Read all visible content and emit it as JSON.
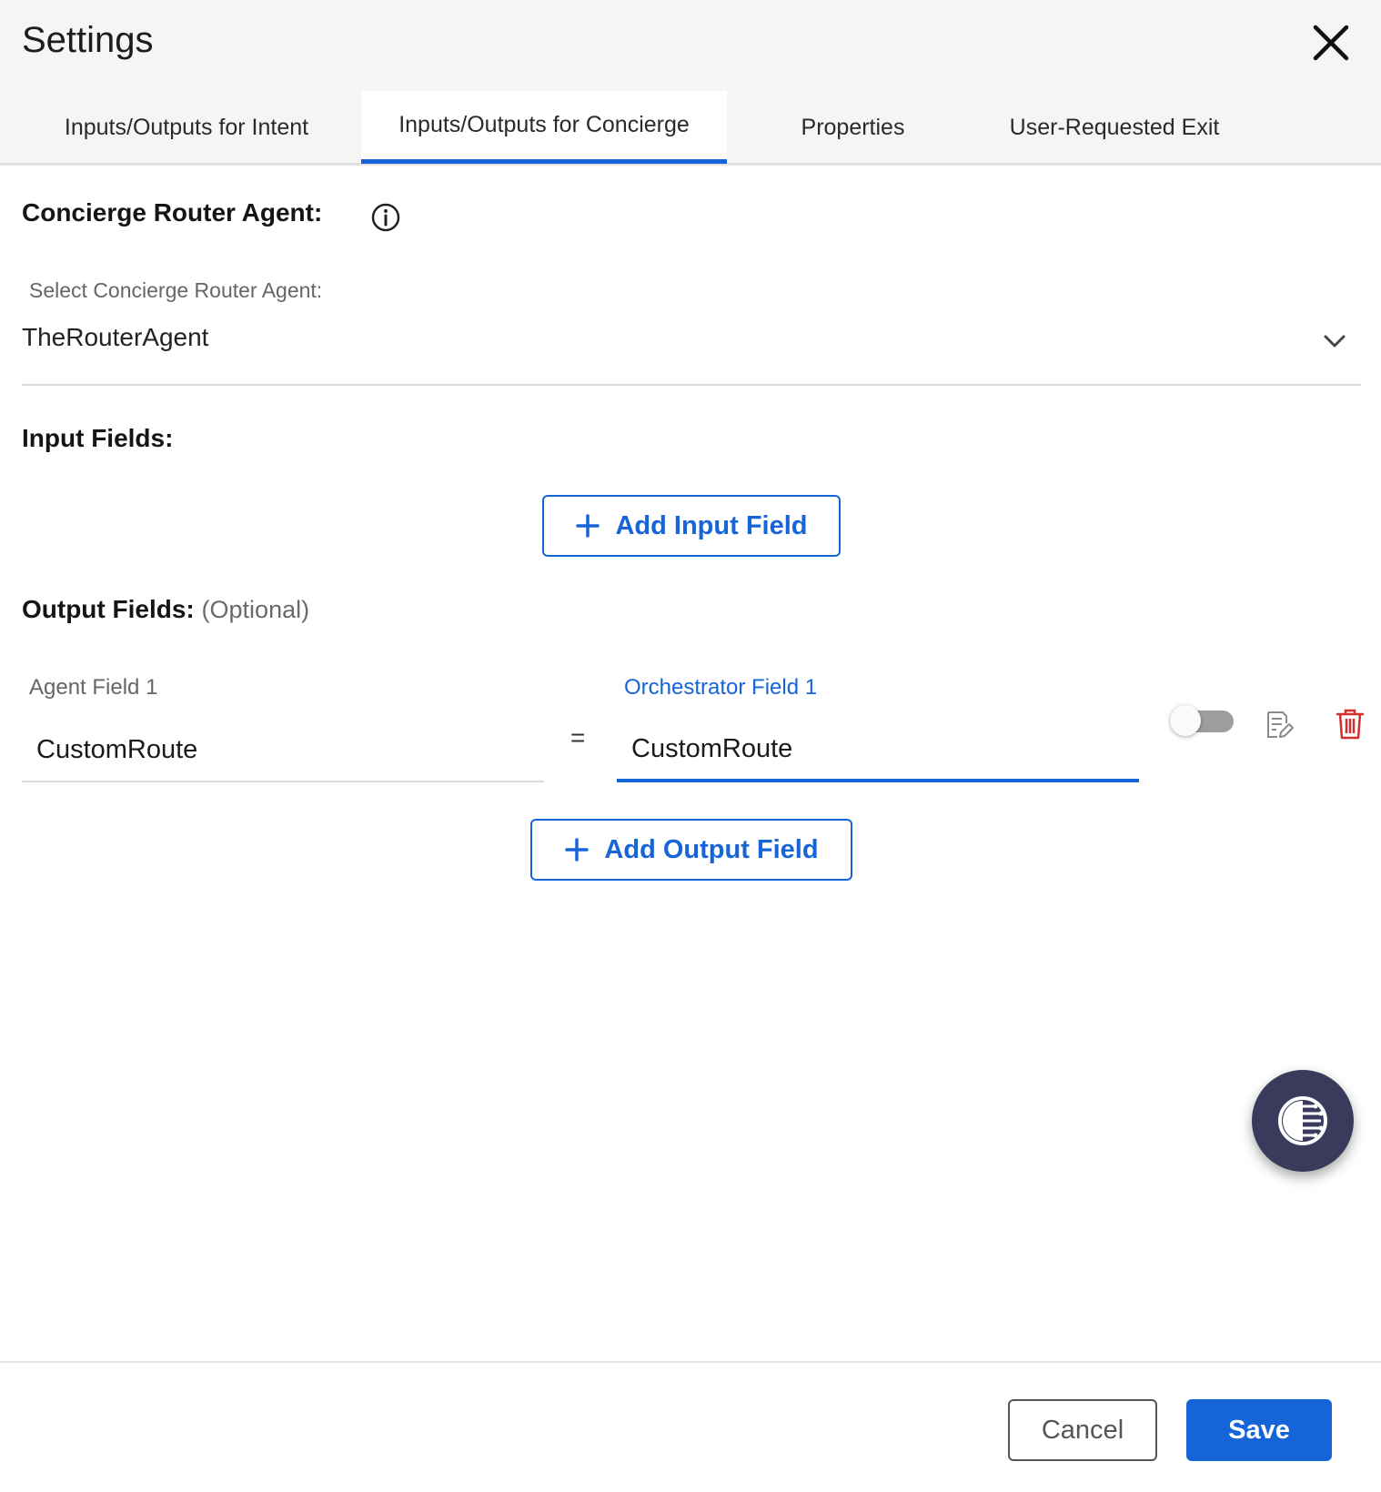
{
  "dialog": {
    "title": "Settings"
  },
  "tabs": [
    {
      "label": "Inputs/Outputs for Intent",
      "active": false
    },
    {
      "label": "Inputs/Outputs for Concierge",
      "active": true
    },
    {
      "label": "Properties",
      "active": false
    },
    {
      "label": "User-Requested Exit",
      "active": false
    }
  ],
  "concierge": {
    "heading": "Concierge Router Agent:",
    "select_label": "Select Concierge Router Agent:",
    "select_value": "TheRouterAgent"
  },
  "input_fields": {
    "heading": "Input Fields:",
    "add_label": "Add Input Field"
  },
  "output_fields": {
    "heading": "Output Fields:",
    "optional_label": "(Optional)",
    "add_label": "Add Output Field",
    "rows": [
      {
        "agent_label": "Agent Field 1",
        "agent_value": "CustomRoute",
        "equals": "=",
        "orchestrator_label": "Orchestrator Field 1",
        "orchestrator_value": "CustomRoute",
        "toggle_on": false
      }
    ]
  },
  "footer": {
    "cancel_label": "Cancel",
    "save_label": "Save"
  },
  "colors": {
    "accent": "#1565d8",
    "delete": "#d32f2f",
    "fab": "#3a3b5c"
  },
  "icons": {
    "close": "close-icon",
    "info": "info-icon",
    "chevron": "chevron-down-icon",
    "plus": "plus-icon",
    "edit": "edit-icon",
    "trash": "trash-icon",
    "assistant": "assistant-icon"
  }
}
